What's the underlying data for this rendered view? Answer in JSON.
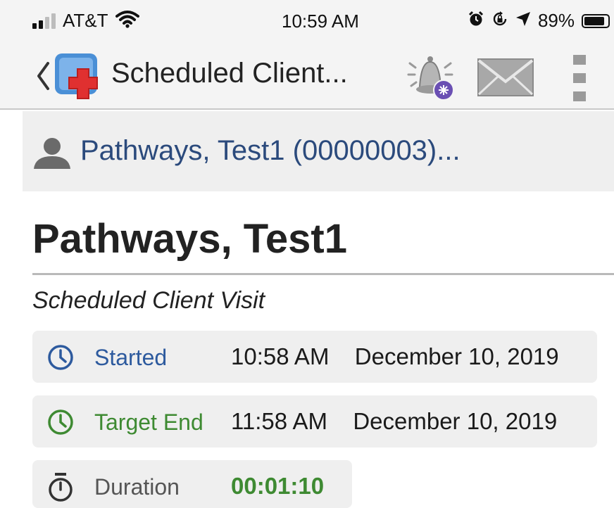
{
  "status_bar": {
    "carrier": "AT&T",
    "time": "10:59 AM",
    "battery": "89%",
    "battery_level": 0.89,
    "signal_bars_active": 2,
    "signal_bars_total": 4
  },
  "nav": {
    "title": "Scheduled Client...",
    "icons": [
      "back-chevron-icon",
      "app-logo-icon",
      "alert-bell-icon",
      "mail-icon",
      "more-vertical-icon"
    ]
  },
  "client_header": {
    "text": "Pathways, Test1 (00000003)...",
    "icon": "person-icon"
  },
  "client": {
    "name": "Pathways, Test1",
    "visit_type": "Scheduled Client Visit"
  },
  "times": {
    "started": {
      "label": "Started",
      "time": "10:58 AM",
      "date": "December 10, 2019",
      "icon": "clock-icon"
    },
    "target_end": {
      "label": "Target End",
      "time": "11:58 AM",
      "date": "December 10, 2019",
      "icon": "clock-icon"
    },
    "duration": {
      "label": "Duration",
      "value": "00:01:10",
      "icon": "stopwatch-icon"
    }
  },
  "colors": {
    "link_blue": "#2b4a7c",
    "started_blue": "#2d5a9e",
    "target_green": "#3e8a32",
    "card_bg": "#efefef",
    "bar_bg": "#f4f4f4",
    "logo_red": "#e03030",
    "logo_blue": "#4a8fd6",
    "badge_purple": "#6a4fb3"
  }
}
